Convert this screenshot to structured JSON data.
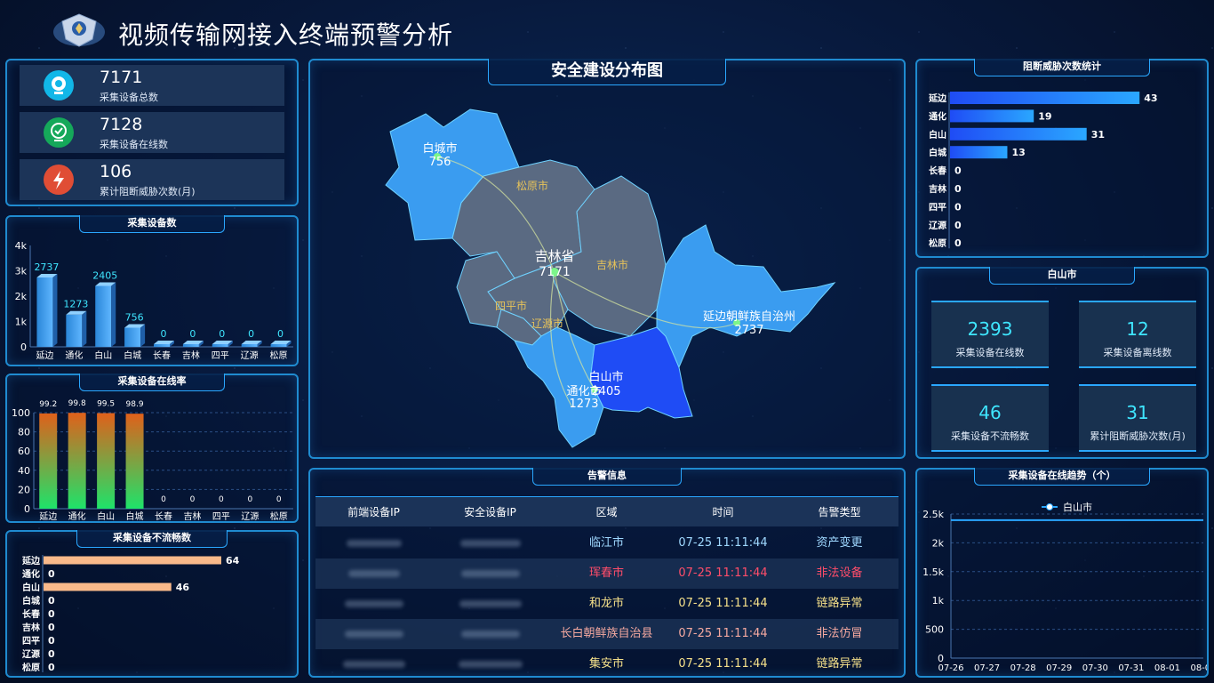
{
  "header": {
    "title": "视频传输网接入终端预警分析"
  },
  "stats": [
    {
      "value": "7171",
      "label": "采集设备总数",
      "color": "#11b7e8",
      "icon": "camera-icon"
    },
    {
      "value": "7128",
      "label": "采集设备在线数",
      "color": "#15a85a",
      "icon": "check-shield-icon"
    },
    {
      "value": "106",
      "label": "累计阻断威胁次数(月)",
      "color": "#e04d35",
      "icon": "lightning-icon"
    }
  ],
  "device_count": {
    "title": "采集设备数"
  },
  "online_rate": {
    "title": "采集设备在线率"
  },
  "unsmooth": {
    "title": "采集设备不流畅数"
  },
  "map": {
    "title": "安全建设分布图",
    "province_label": "吉林省",
    "province_value": "7171",
    "cities": [
      {
        "name": "白城市",
        "value": "756"
      },
      {
        "name": "松原市"
      },
      {
        "name": "吉林市"
      },
      {
        "name": "四平市"
      },
      {
        "name": "辽源市"
      },
      {
        "name": "白山市",
        "value": "2405"
      },
      {
        "name": "通化市",
        "value": "1273"
      },
      {
        "name": "延边朝鲜族自治州",
        "value": "2737"
      }
    ]
  },
  "block_stats": {
    "title": "阻断威胁次数统计"
  },
  "city_panel": {
    "title": "白山市",
    "cards": [
      {
        "value": "2393",
        "label": "采集设备在线数"
      },
      {
        "value": "12",
        "label": "采集设备离线数"
      },
      {
        "value": "46",
        "label": "采集设备不流畅数"
      },
      {
        "value": "31",
        "label": "累计阻断威胁次数(月)"
      }
    ]
  },
  "alerts": {
    "title": "告警信息",
    "columns": [
      "前端设备IP",
      "安全设备IP",
      "区域",
      "时间",
      "告警类型"
    ],
    "rows": [
      {
        "region": "临江市",
        "time": "07-25 11:11:44",
        "type": "资产变更",
        "color": "#9fd8ff"
      },
      {
        "region": "珲春市",
        "time": "07-25 11:11:44",
        "type": "非法设备",
        "color": "#ff4d6a"
      },
      {
        "region": "和龙市",
        "time": "07-25 11:11:44",
        "type": "链路异常",
        "color": "#f5e08a"
      },
      {
        "region": "长白朝鲜族自治县",
        "time": "07-25 11:11:44",
        "type": "非法仿冒",
        "color": "#f5a9a0"
      },
      {
        "region": "集安市",
        "time": "07-25 11:11:44",
        "type": "链路异常",
        "color": "#f5e08a"
      }
    ]
  },
  "trend": {
    "title": "采集设备在线趋势（个）"
  },
  "chart_data": [
    {
      "type": "bar",
      "title": "采集设备数",
      "categories": [
        "延边",
        "通化",
        "白山",
        "白城",
        "长春",
        "吉林",
        "四平",
        "辽源",
        "松原"
      ],
      "values": [
        2737,
        1273,
        2405,
        756,
        0,
        0,
        0,
        0,
        0
      ],
      "ylim": [
        0,
        4000
      ],
      "yticks": [
        "0",
        "1k",
        "2k",
        "3k",
        "4k"
      ],
      "color": "#3aa0ee"
    },
    {
      "type": "bar",
      "title": "采集设备在线率",
      "categories": [
        "延边",
        "通化",
        "白山",
        "白城",
        "长春",
        "吉林",
        "四平",
        "辽源",
        "松原"
      ],
      "values": [
        99.2,
        99.8,
        99.5,
        98.9,
        0,
        0,
        0,
        0,
        0
      ],
      "ylim": [
        0,
        100
      ],
      "yticks": [
        "0",
        "20",
        "40",
        "60",
        "80",
        "100"
      ]
    },
    {
      "type": "bar",
      "orientation": "horizontal",
      "title": "采集设备不流畅数",
      "categories": [
        "延边",
        "通化",
        "白山",
        "白城",
        "长春",
        "吉林",
        "四平",
        "辽源",
        "松原"
      ],
      "values": [
        64,
        0,
        46,
        0,
        0,
        0,
        0,
        0,
        0
      ],
      "xlim": [
        0,
        80
      ],
      "color": "#f9b98a"
    },
    {
      "type": "bar",
      "orientation": "horizontal",
      "title": "阻断威胁次数统计",
      "categories": [
        "延边",
        "通化",
        "白山",
        "白城",
        "长春",
        "吉林",
        "四平",
        "辽源",
        "松原"
      ],
      "values": [
        43,
        19,
        31,
        13,
        0,
        0,
        0,
        0,
        0
      ],
      "xlim": [
        0,
        48
      ],
      "color": "#2a7cf0"
    },
    {
      "type": "line",
      "title": "采集设备在线趋势（个）",
      "x": [
        "07-26",
        "07-27",
        "07-28",
        "07-29",
        "07-30",
        "07-31",
        "08-01",
        "08-02"
      ],
      "series": [
        {
          "name": "白山市",
          "values": [
            2393,
            2393,
            2393,
            2393,
            2393,
            2393,
            2393,
            2393
          ]
        }
      ],
      "ylim": [
        0,
        2500
      ],
      "yticks": [
        "0",
        "500",
        "1k",
        "1.5k",
        "2k",
        "2.5k"
      ],
      "legend": "top-center",
      "color": "#2aa7ff"
    }
  ]
}
